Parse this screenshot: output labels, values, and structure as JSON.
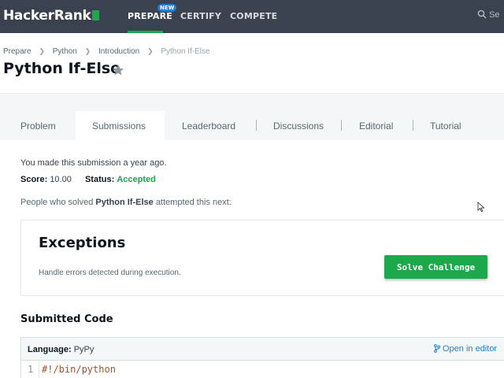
{
  "navbar": {
    "logo": "HackerRank",
    "items": [
      {
        "label": "PREPARE",
        "active": true
      },
      {
        "label": "CERTIFY",
        "active": false
      },
      {
        "label": "COMPETE",
        "active": false
      }
    ],
    "badge": "NEW",
    "search_label": "Se"
  },
  "breadcrumb": [
    "Prepare",
    "Python",
    "Introduction",
    "Python If-Else"
  ],
  "title": "Python If-Else",
  "tabs": [
    {
      "label": "Problem"
    },
    {
      "label": "Submissions",
      "active": true
    },
    {
      "label": "Leaderboard"
    },
    {
      "label": "Discussions"
    },
    {
      "label": "Editorial"
    },
    {
      "label": "Tutorial"
    }
  ],
  "submission": {
    "note": "You made this submission a year ago.",
    "score_label": "Score:",
    "score_value": "10.00",
    "status_label": "Status:",
    "status_value": "Accepted"
  },
  "next": {
    "prefix": "People who solved",
    "challenge": "Python If-Else",
    "suffix": "attempted this next:"
  },
  "card": {
    "title": "Exceptions",
    "description": "Handle errors detected during execution.",
    "button": "Solve Challenge"
  },
  "code": {
    "section_title": "Submitted Code",
    "language_label": "Language:",
    "language": "PyPy",
    "open_editor": "Open in editor",
    "lines": [
      {
        "num": "1",
        "text": "#!/bin/python"
      }
    ]
  },
  "colors": {
    "navbar": "#39424e",
    "accent_green": "#1ba94c",
    "link_blue": "#1c80d8"
  }
}
